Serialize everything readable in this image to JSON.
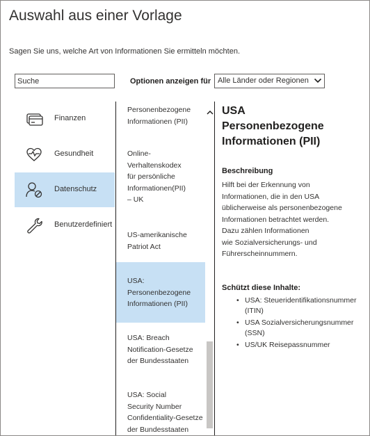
{
  "dialog": {
    "title": "Auswahl aus einer Vorlage",
    "subtitle": "Sagen Sie uns, welche Art von Informationen Sie ermitteln möchten."
  },
  "search": {
    "placeholder": "Suche"
  },
  "filter": {
    "label": "Optionen anzeigen für",
    "selected": "Alle Länder oder Regionen"
  },
  "categories": [
    {
      "label": "Finanzen",
      "icon": "credit-card-icon"
    },
    {
      "label": "Gesundheit",
      "icon": "heart-pulse-icon"
    },
    {
      "label": "Datenschutz",
      "icon": "user-block-icon",
      "selected": true
    },
    {
      "label": "Benutzerdefiniert",
      "icon": "wrench-icon"
    }
  ],
  "templates": [
    {
      "lines": [
        "Personenbezogene",
        "Informationen (PII)"
      ]
    },
    {
      "lines": [
        "Online-",
        "Verhaltenskodex",
        "für persönliche",
        "Informationen(PII)",
        "– UK"
      ]
    },
    {
      "lines": [
        "US-amerikanische",
        "Patriot Act"
      ]
    },
    {
      "lines": [
        "USA:",
        "Personenbezogene",
        "Informationen (PII)"
      ],
      "selected": true
    },
    {
      "lines": [
        "USA: Breach",
        "Notification-Gesetze",
        "der Bundesstaaten"
      ]
    },
    {
      "lines": [
        "USA: Social",
        "Security Number",
        "Confidentiality-Gesetze",
        "der Bundesstaaten"
      ]
    }
  ],
  "detail": {
    "title_lines": [
      "USA",
      "Personenbezogene",
      "Informationen (PII)"
    ],
    "description_heading": "Beschreibung",
    "description_lines": [
      "Hilft bei der Erkennung von",
      "Informationen, die in den USA",
      "üblicherweise als personenbezogene",
      "Informationen betrachtet werden.",
      "Dazu zählen Informationen",
      "wie Sozialversicherungs- und",
      "Führerscheinnummern."
    ],
    "protects_heading": "Schützt diese Inhalte:",
    "protects_items": [
      {
        "lines": [
          "USA: Steueridentifikationsnummer",
          "(ITIN)"
        ]
      },
      {
        "lines": [
          "USA Sozialversicherungsnummer",
          "(SSN)"
        ]
      },
      {
        "lines": [
          "US/UK Reisepassnummer"
        ]
      }
    ]
  },
  "colors": {
    "selection": "#c7e0f4",
    "text": "#323130",
    "border": "#605e5c"
  }
}
